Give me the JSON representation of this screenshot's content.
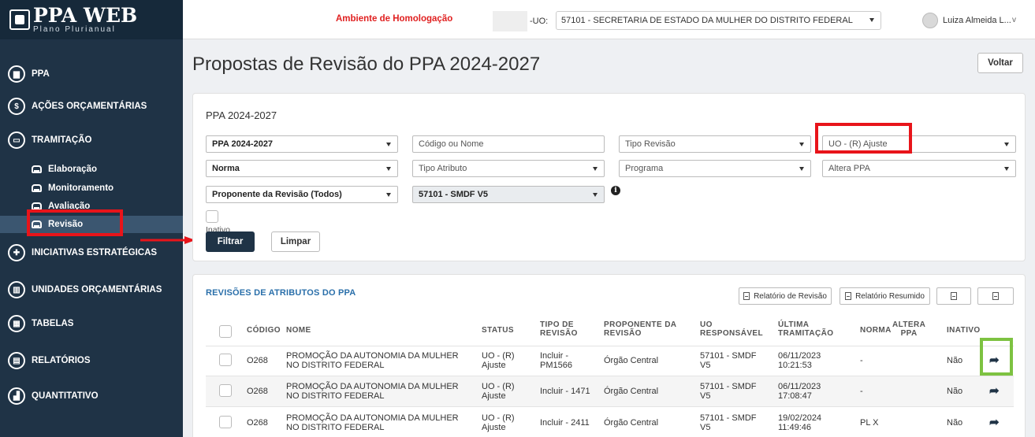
{
  "logo": {
    "title": "PPA WEB",
    "subtitle": "Plano Plurianual"
  },
  "topbar": {
    "environment": "Ambiente de Homologação",
    "uo_label": "-UO:",
    "uo_value": "57101 - SECRETARIA DE ESTADO DA MULHER DO DISTRITO FEDERAL",
    "user_name": "Luiza Almeida L...",
    "user_chevron": "v"
  },
  "sidebar": {
    "items": [
      {
        "label": "PPA",
        "icon": "book-icon",
        "glyph": "▆"
      },
      {
        "label": "AÇÕES ORÇAMENTÁRIAS",
        "icon": "dollar-icon",
        "glyph": "$"
      },
      {
        "label": "TRAMITAÇÃO",
        "icon": "inbox-icon",
        "glyph": "▭"
      },
      {
        "label": "INICIATIVAS ESTRATÉGICAS",
        "icon": "puzzle-icon",
        "glyph": "✚"
      },
      {
        "label": "UNIDADES ORÇAMENTÁRIAS",
        "icon": "bank-icon",
        "glyph": "▥"
      },
      {
        "label": "TABELAS",
        "icon": "table-icon",
        "glyph": "▦"
      },
      {
        "label": "RELATÓRIOS",
        "icon": "report-icon",
        "glyph": "▤"
      },
      {
        "label": "QUANTITATIVO",
        "icon": "bar-chart-icon",
        "glyph": "▟"
      }
    ],
    "sub_items": [
      {
        "label": "Elaboração"
      },
      {
        "label": "Monitoramento"
      },
      {
        "label": "Avaliação"
      },
      {
        "label": "Revisão"
      }
    ]
  },
  "page": {
    "title": "Propostas de Revisão do PPA 2024-2027",
    "back_label": "Voltar"
  },
  "filters": {
    "title": "PPA 2024-2027",
    "ppa": "PPA 2024-2027",
    "codigo_placeholder": "Código ou Nome",
    "tipo_revisao": "Tipo Revisão",
    "uo_ajuste": "UO - (R) Ajuste",
    "norma": "Norma",
    "tipo_atributo": "Tipo Atributo",
    "programa": "Programa",
    "altera_ppa": "Altera PPA",
    "proponente": "Proponente da Revisão (Todos)",
    "uo_code": "57101 - SMDF V5",
    "inativo_label": "Inativo",
    "filter_label": "Filtrar",
    "clear_label": "Limpar"
  },
  "table": {
    "title": "REVISÕES DE ATRIBUTOS DO PPA",
    "buttons": {
      "relatorio_revisao": "Relatório de Revisão",
      "relatorio_resumido": "Relatório Resumido"
    },
    "headers": {
      "codigo": "CÓDIGO",
      "nome": "NOME",
      "status": "STATUS",
      "tipo_line1": "TIPO DE",
      "tipo_line2": "REVISÃO",
      "prop_line1": "PROPONENTE DA",
      "prop_line2": "REVISÃO",
      "uo_line1": "UO",
      "uo_line2": "RESPONSÁVEL",
      "ult_line1": "ÚLTIMA",
      "ult_line2": "TRAMITAÇÃO",
      "norma": "NORMA",
      "altera_line1": "ALTERA",
      "altera_line2": "PPA",
      "inativo": "INATIVO"
    },
    "rows": [
      {
        "codigo": "O268",
        "nome_1": "PROMOÇÃO DA AUTONOMIA DA MULHER",
        "nome_2": "NO DISTRITO FEDERAL",
        "status_1": "UO - (R)",
        "status_2": "Ajuste",
        "tipo_1": "Incluir -",
        "tipo_2": "PM1566",
        "proponente": "Órgão Central",
        "uo_1": "57101 - SMDF",
        "uo_2": "V5",
        "data": "06/11/2023",
        "hora": "10:21:53",
        "norma": "-",
        "inativo": "Não"
      },
      {
        "codigo": "O268",
        "nome_1": "PROMOÇÃO DA AUTONOMIA DA MULHER",
        "nome_2": "NO DISTRITO FEDERAL",
        "status_1": "UO - (R)",
        "status_2": "Ajuste",
        "tipo_1": "Incluir - 1471",
        "tipo_2": "",
        "proponente": "Órgão Central",
        "uo_1": "57101 - SMDF",
        "uo_2": "V5",
        "data": "06/11/2023",
        "hora": "17:08:47",
        "norma": "-",
        "inativo": "Não"
      },
      {
        "codigo": "O268",
        "nome_1": "PROMOÇÃO DA AUTONOMIA DA MULHER",
        "nome_2": "NO DISTRITO FEDERAL",
        "status_1": "UO - (R)",
        "status_2": "Ajuste",
        "tipo_1": "Incluir - 2411",
        "tipo_2": "",
        "proponente": "Órgão Central",
        "uo_1": "57101 - SMDF",
        "uo_2": "V5",
        "data": "19/02/2024",
        "hora": "11:49:46",
        "norma": "PL X",
        "inativo": "Não"
      }
    ],
    "action_glyph": "➦"
  },
  "colors": {
    "sidebar": "#1f3346",
    "highlight_red": "#e8141a",
    "highlight_green": "#7dc241",
    "link_blue": "#2a6faa"
  }
}
